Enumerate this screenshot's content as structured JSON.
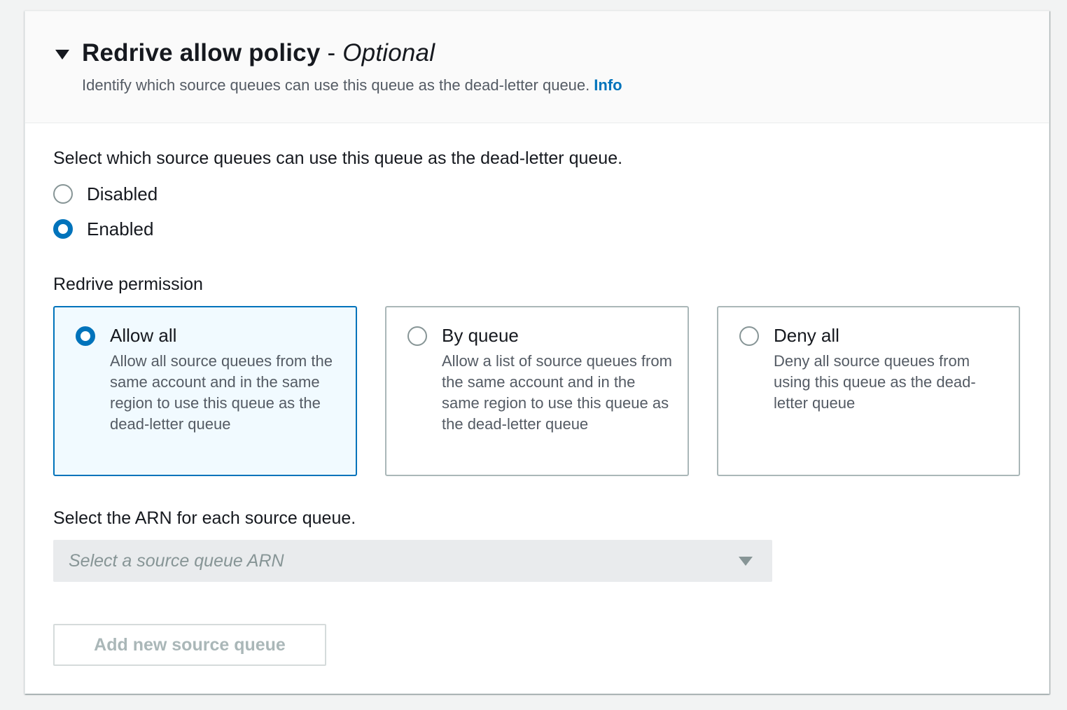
{
  "section": {
    "title": "Redrive allow policy",
    "separator": "-",
    "optional_label": "Optional",
    "description": "Identify which source queues can use this queue as the dead-letter queue.",
    "info_link": "Info",
    "expand_icon": "caret-down-icon"
  },
  "enable_group": {
    "label": "Select which source queues can use this queue as the dead-letter queue.",
    "options": [
      {
        "label": "Disabled",
        "checked": false
      },
      {
        "label": "Enabled",
        "checked": true
      }
    ]
  },
  "permission": {
    "label": "Redrive permission",
    "tiles": [
      {
        "title": "Allow all",
        "description": "Allow all source queues from the same account and in the same region to use this queue as the dead-letter queue",
        "selected": true
      },
      {
        "title": "By queue",
        "description": "Allow a list of source queues from the same account and in the same region to use this queue as the dead-letter queue",
        "selected": false
      },
      {
        "title": "Deny all",
        "description": "Deny all source queues from using this queue as the dead-letter queue",
        "selected": false
      }
    ]
  },
  "arn": {
    "label": "Select the ARN for each source queue.",
    "placeholder": "Select a source queue ARN",
    "dropdown_icon": "caret-down-icon",
    "disabled": true
  },
  "add_button": {
    "label": "Add new source queue",
    "disabled": true
  },
  "colors": {
    "accent": "#0073bb",
    "selected_tile_bg": "#f1faff",
    "header_bg": "#fafafa",
    "page_bg": "#f2f3f3",
    "disabled_text": "#aab7b8",
    "select_bg": "#e9ebed"
  }
}
